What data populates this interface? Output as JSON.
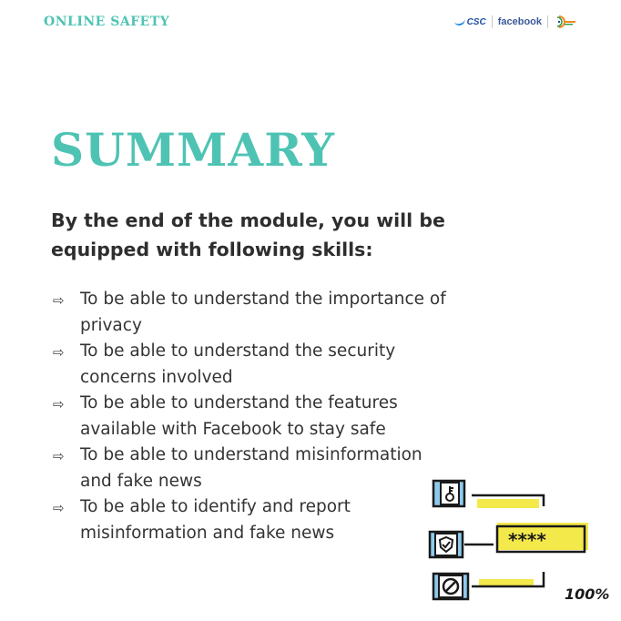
{
  "header": {
    "title": "ONLINE SAFETY",
    "logos": [
      {
        "name": "csc-logo",
        "text": "CSC"
      },
      {
        "name": "facebook-logo",
        "text": "facebook"
      },
      {
        "name": "digital-india-logo",
        "text": ""
      }
    ]
  },
  "main": {
    "heading": "SUMMARY",
    "intro_line1": "By the end of the module, you will be",
    "intro_line2": "equipped with following skills:",
    "skills": [
      {
        "line1": "To be able to understand the importance of",
        "line2": "privacy"
      },
      {
        "line1": "To be able to understand the security",
        "line2": "concerns involved"
      },
      {
        "line1": "To be able to understand the features",
        "line2": "available with Facebook to stay safe"
      },
      {
        "line1": "To be able to  understand misinformation",
        "line2": "and fake news"
      },
      {
        "line1": "To be able to identify and report",
        "line2": "misinformation and fake news"
      }
    ],
    "bullet_icon": "outline-arrow-icon"
  },
  "illustration": {
    "password_mask": "****",
    "strength_label": "100%",
    "icons": [
      "key-icon",
      "shield-check-icon",
      "blocked-icon"
    ]
  },
  "colors": {
    "accent": "#4ec3b3",
    "highlight_yellow": "#f4e94a",
    "icon_blue": "#6bb3e0",
    "text_dark": "#2e2e2e"
  }
}
